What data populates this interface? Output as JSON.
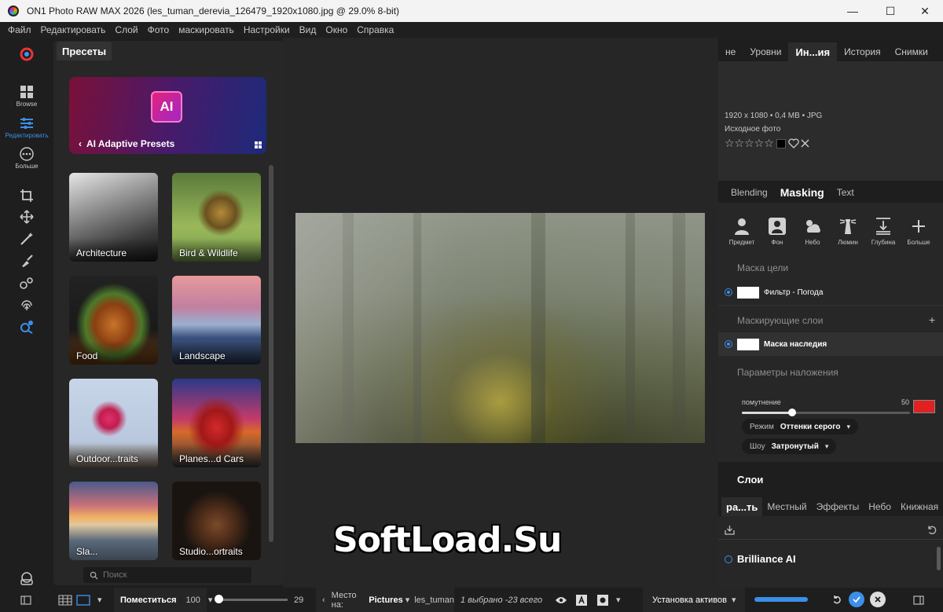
{
  "window": {
    "title": "ON1 Photo RAW MAX 2026 (les_tuman_derevia_126479_1920x1080.jpg @ 29.0% 8-bit)",
    "minimize": "—",
    "maximize": "☐",
    "close": "✕"
  },
  "menu": [
    "Файл",
    "Редактировать",
    "Слой",
    "Фото",
    "маскировать",
    "Настройки",
    "Вид",
    "Окно",
    "Справка"
  ],
  "tools": {
    "browse": "Browse",
    "edit": "Редактировать",
    "more": "Больше"
  },
  "presets": {
    "tab": "Пресеты",
    "ai_chip": "AI",
    "ai_label": "AI Adaptive Presets",
    "back": "‹",
    "cards": [
      "Architecture",
      "Bird & Wildlife",
      "Food",
      "Landscape",
      "Outdoor...traits",
      "Planes...d Cars",
      "Sla...",
      "Studio...ortraits"
    ],
    "search_placeholder": "Поиск"
  },
  "watermark": "SoftLoad.Su",
  "right_tabs": [
    "не",
    "Уровни",
    "Ин...ия",
    "История",
    "Снимки"
  ],
  "info": {
    "meta": "1920 x 1080 • 0,4 MB • JPG",
    "source": "Исходное фото",
    "stars": "☆☆☆☆☆"
  },
  "mask_tabs": [
    "Blending",
    "Masking",
    "Text"
  ],
  "mask_tools": [
    "Предмет",
    "Фон",
    "Небо",
    "Люмин",
    "Глубина",
    "Больше"
  ],
  "mask": {
    "target_title": "Маска цели",
    "target_item": "Фильтр - Погода",
    "layers_title": "Маскирующие слои",
    "layer_item": "Маска наследия",
    "params_title": "Параметры наложения",
    "slider_label": "помутнение",
    "slider_value": "50",
    "slider_fraction": 0.3,
    "mode_label": "Режим",
    "mode_value": "Оттенки серого",
    "show_label": "Шоу",
    "show_value": "Затронутый",
    "add": "+",
    "swatch_color": "#e02121"
  },
  "layers": {
    "title": "Слои",
    "tabs": [
      "ра...ть",
      "Местный",
      "Эффекты",
      "Небо",
      "Книжная"
    ],
    "item": "Brilliance AI"
  },
  "bottom": {
    "fit": "Поместиться",
    "zoom": "100",
    "count": "29",
    "place_label": "Место на:",
    "place_value": "Pictures",
    "file": "les_tuman",
    "selection": "1 выбрано -23 всего",
    "install": "Установка активов",
    "progress": 1.0
  },
  "colors": {
    "accent": "#3b8fe8"
  }
}
